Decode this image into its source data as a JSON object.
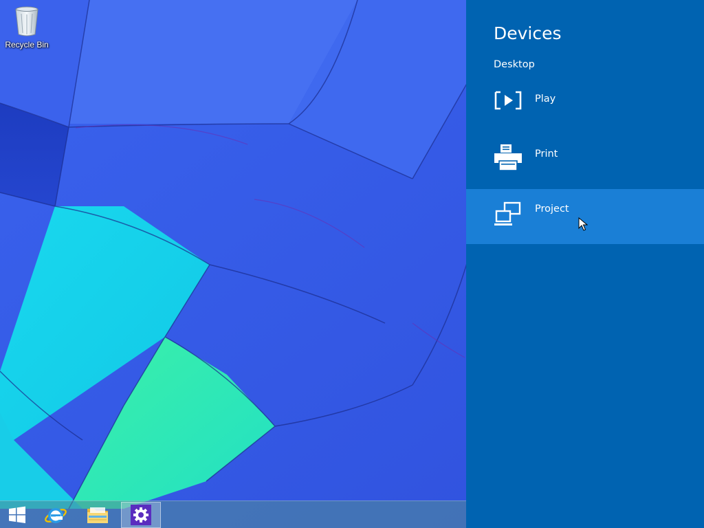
{
  "desktop": {
    "icons": [
      {
        "label": "Recycle Bin",
        "icon": "recycle-bin-icon"
      }
    ]
  },
  "taskbar": {
    "buttons": [
      {
        "name": "start",
        "icon": "windows-logo-icon"
      },
      {
        "name": "internet-explorer",
        "icon": "internet-explorer-icon"
      },
      {
        "name": "file-explorer",
        "icon": "folder-icon"
      },
      {
        "name": "settings",
        "icon": "gear-icon",
        "active": true
      }
    ]
  },
  "charm_pane": {
    "title": "Devices",
    "subtitle": "Desktop",
    "items": [
      {
        "label": "Play",
        "icon": "play-to-device-icon"
      },
      {
        "label": "Print",
        "icon": "printer-icon"
      },
      {
        "label": "Project",
        "icon": "project-screen-icon",
        "highlighted": true
      }
    ],
    "colors": {
      "background": "#0063b1",
      "highlight": "#1a7fd6"
    }
  }
}
